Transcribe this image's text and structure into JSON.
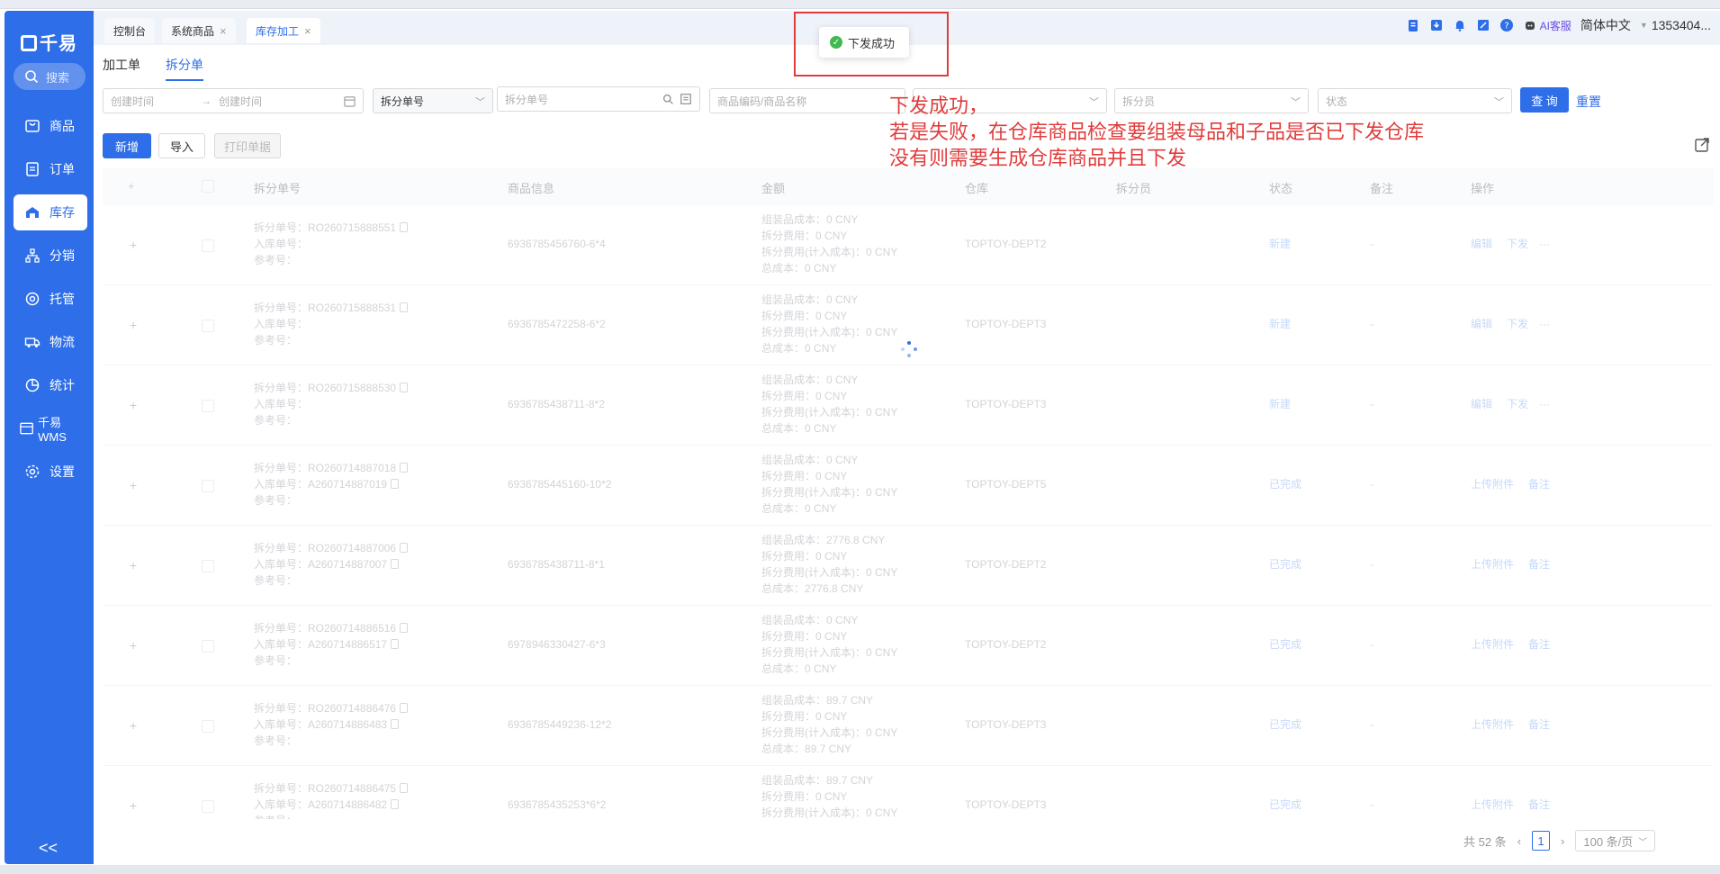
{
  "sidebar": {
    "logo": "千易",
    "search": "搜索",
    "items": [
      {
        "label": "商品",
        "icon": "product-icon"
      },
      {
        "label": "订单",
        "icon": "order-icon"
      },
      {
        "label": "库存",
        "icon": "warehouse-icon"
      },
      {
        "label": "分销",
        "icon": "distribution-icon"
      },
      {
        "label": "托管",
        "icon": "hosting-icon"
      },
      {
        "label": "物流",
        "icon": "truck-icon"
      },
      {
        "label": "统计",
        "icon": "pie-chart-icon"
      },
      {
        "label": "千易WMS",
        "icon": "wms-icon"
      },
      {
        "label": "设置",
        "icon": "gear-icon"
      }
    ],
    "collapse": "<<"
  },
  "tabs": [
    {
      "label": "控制台"
    },
    {
      "label": "系统商品"
    },
    {
      "label": "库存加工"
    }
  ],
  "header": {
    "ai_service": "AI客服",
    "language": "简体中文",
    "user": "1353404..."
  },
  "subtabs": [
    "加工单",
    "拆分单"
  ],
  "filters": {
    "created_time_start": "创建时间",
    "created_time_end": "创建时间",
    "arrow": "→",
    "order_type": "拆分单号",
    "order_no_placeholder": "拆分单号",
    "product_placeholder": "商品编码/商品名称",
    "splitter_placeholder": "拆分员",
    "status_placeholder": "状态",
    "query": "查 询",
    "reset": "重置"
  },
  "actions": {
    "new": "新增",
    "import": "导入",
    "print": "打印单据"
  },
  "table": {
    "headers": [
      "拆分单号",
      "商品信息",
      "金额",
      "仓库",
      "拆分员",
      "状态",
      "备注",
      "操作"
    ],
    "labels": {
      "split_no": "拆分单号：",
      "in_no": "入库单号：",
      "ref_no": "参考号：",
      "assembly_cost": "组装品成本：",
      "split_fee": "拆分费用：",
      "split_fee_incl": "拆分费用(计入成本)：",
      "total_cost": "总成本："
    },
    "rows": [
      {
        "split_no": "RO260715888551",
        "in_no": "",
        "product": "6936785456760-6*4",
        "assembly": "0 CNY",
        "fee": "0 CNY",
        "fee_incl": "0 CNY",
        "total": "0 CNY",
        "warehouse": "TOPTOY-DEPT2",
        "status": "新建",
        "remark": "-",
        "op1": "编辑",
        "op2": "下发",
        "op3": "···"
      },
      {
        "split_no": "RO260715888531",
        "in_no": "",
        "product": "6936785472258-6*2",
        "assembly": "0 CNY",
        "fee": "0 CNY",
        "fee_incl": "0 CNY",
        "total": "0 CNY",
        "warehouse": "TOPTOY-DEPT3",
        "status": "新建",
        "remark": "-",
        "op1": "编辑",
        "op2": "下发",
        "op3": "···"
      },
      {
        "split_no": "RO260715888530",
        "in_no": "",
        "product": "6936785438711-8*2",
        "assembly": "0 CNY",
        "fee": "0 CNY",
        "fee_incl": "0 CNY",
        "total": "0 CNY",
        "warehouse": "TOPTOY-DEPT3",
        "status": "新建",
        "remark": "-",
        "op1": "编辑",
        "op2": "下发",
        "op3": "···"
      },
      {
        "split_no": "RO260714887018",
        "in_no": "A260714887019",
        "product": "6936785445160-10*2",
        "assembly": "0 CNY",
        "fee": "0 CNY",
        "fee_incl": "0 CNY",
        "total": "0 CNY",
        "warehouse": "TOPTOY-DEPT5",
        "status": "已完成",
        "remark": "-",
        "op1": "上传附件",
        "op2": "备注",
        "op3": ""
      },
      {
        "split_no": "RO260714887006",
        "in_no": "A260714887007",
        "product": "6936785438711-8*1",
        "assembly": "2776.8 CNY",
        "fee": "0 CNY",
        "fee_incl": "0 CNY",
        "total": "2776.8 CNY",
        "warehouse": "TOPTOY-DEPT2",
        "status": "已完成",
        "remark": "-",
        "op1": "上传附件",
        "op2": "备注",
        "op3": ""
      },
      {
        "split_no": "RO260714886516",
        "in_no": "A260714886517",
        "product": "6978946330427-6*3",
        "assembly": "0 CNY",
        "fee": "0 CNY",
        "fee_incl": "0 CNY",
        "total": "0 CNY",
        "warehouse": "TOPTOY-DEPT2",
        "status": "已完成",
        "remark": "-",
        "op1": "上传附件",
        "op2": "备注",
        "op3": ""
      },
      {
        "split_no": "RO260714886476",
        "in_no": "A260714886483",
        "product": "6936785449236-12*2",
        "assembly": "89.7 CNY",
        "fee": "0 CNY",
        "fee_incl": "0 CNY",
        "total": "89.7 CNY",
        "warehouse": "TOPTOY-DEPT3",
        "status": "已完成",
        "remark": "-",
        "op1": "上传附件",
        "op2": "备注",
        "op3": ""
      },
      {
        "split_no": "RO260714886475",
        "in_no": "A260714886482",
        "product": "6936785435253*6*2",
        "assembly": "89.7 CNY",
        "fee": "0 CNY",
        "fee_incl": "0 CNY",
        "total": "",
        "warehouse": "TOPTOY-DEPT3",
        "status": "已完成",
        "remark": "-",
        "op1": "上传附件",
        "op2": "备注",
        "op3": ""
      }
    ]
  },
  "toast": {
    "message": "下发成功"
  },
  "annotation": {
    "line1": "下发成功，",
    "line2": "若是失败，在仓库商品检查要组装母品和子品是否已下发仓库",
    "line3": "没有则需要生成仓库商品并且下发"
  },
  "pagination": {
    "total": "共 52 条",
    "current": "1",
    "page_size": "100 条/页"
  },
  "colors": {
    "brand": "#2e6ee8",
    "annotation": "#e03c3c",
    "success": "#3fb950"
  }
}
